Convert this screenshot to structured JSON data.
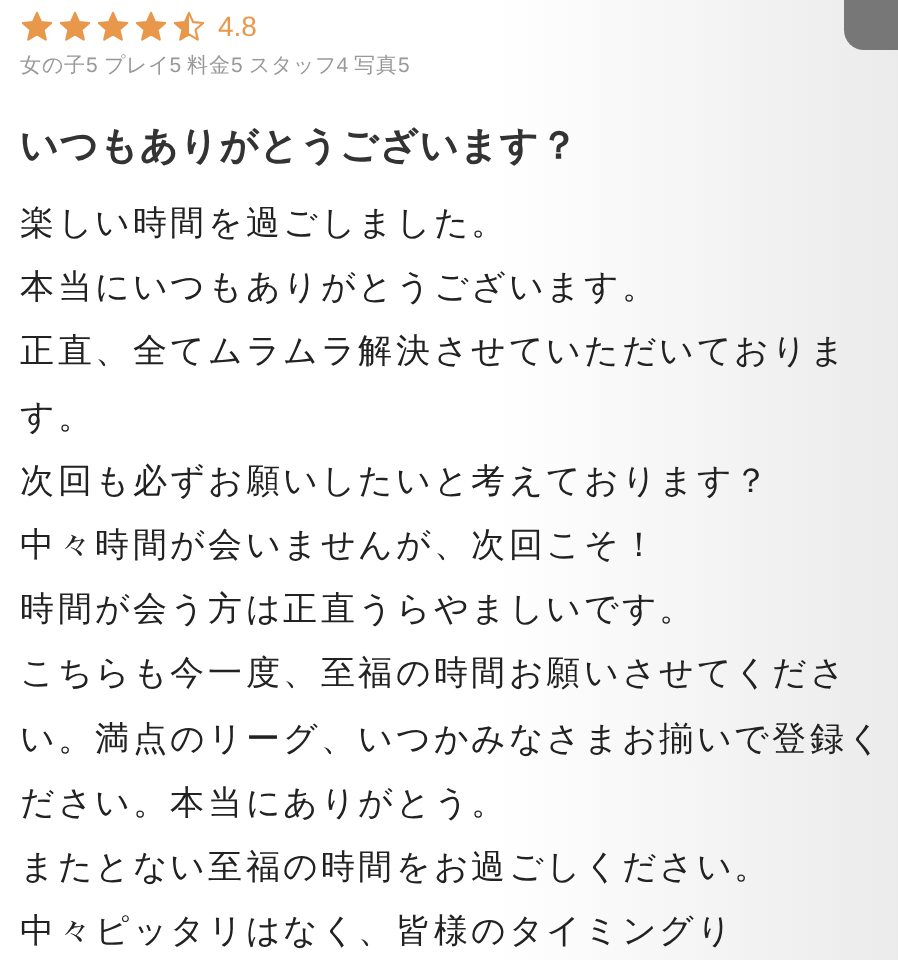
{
  "rating": {
    "stars": 4.5,
    "score": "4.8",
    "breakdown": "女の子5 プレイ5 料金5 スタッフ4 写真5"
  },
  "review": {
    "title": "いつもありがとうございます？",
    "lines": [
      "楽しい時間を過ごしました。",
      "本当にいつもありがとうございます。",
      "正直、全てムラムラ解決させていただいておりま",
      "す。",
      "次回も必ずお願いしたいと考えております？",
      "中々時間が会いませんが、次回こそ！",
      "時間が会う方は正直うらやましいです。",
      "こちらも今一度、至福の時間お願いさせてくださ",
      "い。満点のリーグ、いつかみなさまお揃いで登録く",
      "ださい。本当にありがとう。",
      "またとない至福の時間をお過ごしください。",
      "中々ピッタリはなく、皆様のタイミングり"
    ]
  }
}
